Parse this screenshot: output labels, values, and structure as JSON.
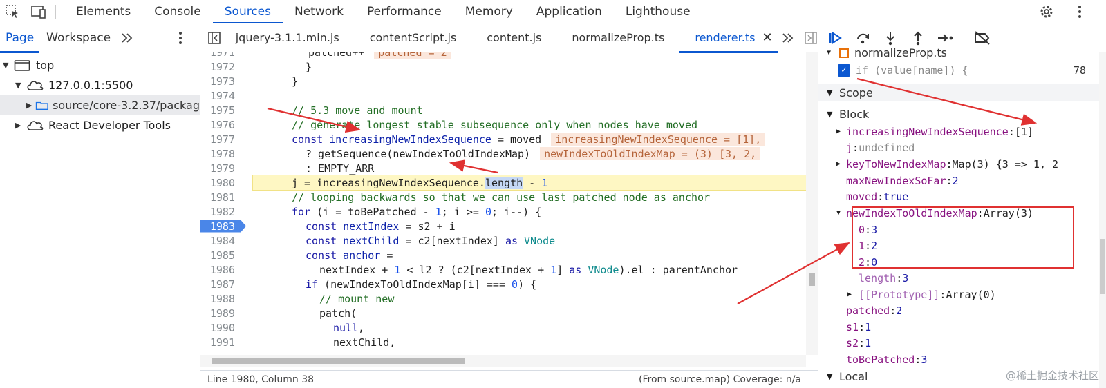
{
  "top_tabs": [
    "Elements",
    "Console",
    "Sources",
    "Network",
    "Performance",
    "Memory",
    "Application",
    "Lighthouse"
  ],
  "active_top_tab": "Sources",
  "left": {
    "tabs": [
      "Page",
      "Workspace"
    ],
    "tree": {
      "top": "top",
      "host": "127.0.0.1:5500",
      "folder": "source/core-3.2.37/packag",
      "react": "React Developer Tools"
    }
  },
  "files": [
    "jquery-3.1.1.min.js",
    "contentScript.js",
    "content.js",
    "normalizeProp.ts",
    "renderer.ts"
  ],
  "active_file": "renderer.ts",
  "code": {
    "l1971_num": "1971",
    "l1971_text": "patched++",
    "l1971_inline": "patched = 2",
    "l1972_num": "1972",
    "l1972_text": "}",
    "l1973_num": "1973",
    "l1973_text": "}",
    "l1974_num": "1974",
    "l1975_num": "1975",
    "l1975_text": "// 5.3 move and mount",
    "l1976_num": "1976",
    "l1976_text": "// generate longest stable subsequence only when nodes have moved",
    "l1977_num": "1977",
    "l1977_kw": "const",
    "l1977_var": "increasingNewIndexSequence",
    "l1977_rest": " = moved",
    "l1977_inline": "increasingNewIndexSequence = [1],",
    "l1978_num": "1978",
    "l1978_text": "? getSequence(newIndexToOldIndexMap)",
    "l1978_inline": "newIndexToOldIndexMap = (3) [3, 2,",
    "l1979_num": "1979",
    "l1979_text": ": EMPTY_ARR",
    "l1980_num": "1980",
    "l1980_a": "j = increasingNewIndexSequence.",
    "l1980_b": "length",
    "l1980_c": " - ",
    "l1980_d": "1",
    "l1981_num": "1981",
    "l1981_text": "// looping backwards so that we can use last patched node as anchor",
    "l1982_num": "1982",
    "l1982_kw": "for",
    "l1982_a": " (i = toBePatched - ",
    "l1982_n1": "1",
    "l1982_b": "; i >= ",
    "l1982_n2": "0",
    "l1982_c": "; i--) {",
    "l1983_num": "1983",
    "l1983_kw": "const",
    "l1983_var": "nextIndex",
    "l1983_rest": " = s2 + i",
    "l1984_num": "1984",
    "l1984_kw": "const",
    "l1984_var": "nextChild",
    "l1984_rest": " = c2[nextIndex] ",
    "l1984_as": "as",
    "l1984_ty": "VNode",
    "l1985_num": "1985",
    "l1985_kw": "const",
    "l1985_var": "anchor",
    "l1985_rest": " =",
    "l1986_num": "1986",
    "l1986_a": "nextIndex + ",
    "l1986_n1": "1",
    "l1986_b": " < l2 ? (c2[nextIndex + ",
    "l1986_n2": "1",
    "l1986_c": "] ",
    "l1986_as": "as",
    "l1986_ty": "VNode",
    "l1986_d": ").el : parentAnchor",
    "l1987_num": "1987",
    "l1987_kw": "if",
    "l1987_a": " (newIndexToOldIndexMap[i] === ",
    "l1987_n": "0",
    "l1987_b": ") {",
    "l1988_num": "1988",
    "l1988_text": "// mount new",
    "l1989_num": "1989",
    "l1989_text": "patch(",
    "l1990_num": "1990",
    "l1990_text": "null",
    "l1991_num": "1991",
    "l1991_text": "nextChild,"
  },
  "status_left": "Line 1980, Column 38",
  "status_right": "(From source.map) Coverage: n/a",
  "breakpoint": {
    "file": "normalizeProp.ts",
    "condition": "if (value[name]) {",
    "line": "78"
  },
  "scope": {
    "title": "Scope",
    "block": "Block",
    "increasing_key": "increasingNewIndexSequence",
    "increasing_val": "[1]",
    "j_key": "j",
    "j_val": "undefined",
    "keymap_key": "keyToNewIndexMap",
    "keymap_val": "Map(3) {3 => 1, 2",
    "max_key": "maxNewIndexSoFar",
    "max_val": "2",
    "moved_key": "moved",
    "moved_val": "true",
    "map_key": "newIndexToOldIndexMap",
    "map_val": "Array(3)",
    "m0_key": "0",
    "m0_val": "3",
    "m1_key": "1",
    "m1_val": "2",
    "m2_key": "2",
    "m2_val": "0",
    "len_key": "length",
    "len_val": "3",
    "proto_key": "[[Prototype]]",
    "proto_val": "Array(0)",
    "patched_key": "patched",
    "patched_val": "2",
    "s1_key": "s1",
    "s1_val": "1",
    "s2_key": "s2",
    "s2_val": "1",
    "tbp_key": "toBePatched",
    "tbp_val": "3",
    "local": "Local"
  },
  "watermark": "@稀土掘金技术社区",
  "colors": {
    "accent": "#0b57d0",
    "annotation_red": "#e03131",
    "breakpoint_blue": "#4a86e8"
  }
}
